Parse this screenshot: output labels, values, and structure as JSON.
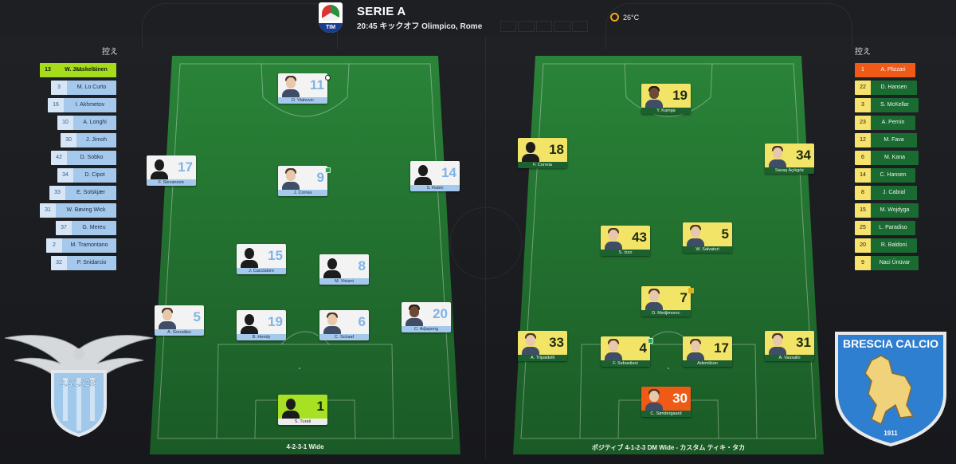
{
  "header": {
    "competition": "SERIE A",
    "subtitle": "20:45 キックオフ Olimpico, Rome",
    "temperature": "26°C",
    "weather_icon": "sun-icon",
    "logo_text": "TIM"
  },
  "home": {
    "bench_title": "控え",
    "formation": "4-2-3-1 Wide",
    "bench": [
      {
        "num": "13",
        "name": "W. Jääskeläinen"
      },
      {
        "num": "3",
        "name": "M. Lo Curto"
      },
      {
        "num": "16",
        "name": "I. Akhmetov"
      },
      {
        "num": "10",
        "name": "A. Longhi"
      },
      {
        "num": "30",
        "name": "J. Jimoh"
      },
      {
        "num": "42",
        "name": "D. Sobko"
      },
      {
        "num": "34",
        "name": "D. Cipot"
      },
      {
        "num": "33",
        "name": "E. Solskjær"
      },
      {
        "num": "31",
        "name": "W. Bøving Wick"
      },
      {
        "num": "37",
        "name": "G. Mereu"
      },
      {
        "num": "2",
        "name": "M. Tramontano"
      },
      {
        "num": "32",
        "name": "P. Snidarcio"
      }
    ],
    "players": [
      {
        "num": "11",
        "name": "D. Vlahovic"
      },
      {
        "num": "17",
        "name": "F. Stevanovic"
      },
      {
        "num": "9",
        "name": "J. Correa"
      },
      {
        "num": "14",
        "name": "S. Rabin"
      },
      {
        "num": "15",
        "name": "J. Cacciatore"
      },
      {
        "num": "8",
        "name": "M. Viviani"
      },
      {
        "num": "5",
        "name": "A. González"
      },
      {
        "num": "19",
        "name": "B. Hendy"
      },
      {
        "num": "6",
        "name": "C. Schaaf"
      },
      {
        "num": "20",
        "name": "C. Adjapong"
      },
      {
        "num": "1",
        "name": "S. Turati"
      }
    ],
    "crest_text": "S.S.LAZIO",
    "crest_color": "#9fc8ea"
  },
  "away": {
    "bench_title": "控え",
    "formation": "ポジティブ 4-1-2-3 DM Wide - カスタム ティキ・タカ",
    "bench": [
      {
        "num": "1",
        "name": "A. Plizzari"
      },
      {
        "num": "22",
        "name": "D. Hansen"
      },
      {
        "num": "3",
        "name": "S. McKellar"
      },
      {
        "num": "23",
        "name": "A. Pernin"
      },
      {
        "num": "12",
        "name": "M. Fava"
      },
      {
        "num": "6",
        "name": "M. Kana"
      },
      {
        "num": "14",
        "name": "C. Hansen"
      },
      {
        "num": "8",
        "name": "J. Cabral"
      },
      {
        "num": "15",
        "name": "M. Wojdyga"
      },
      {
        "num": "25",
        "name": "L. Paradiso"
      },
      {
        "num": "20",
        "name": "R. Baldoni"
      },
      {
        "num": "9",
        "name": "Naci Ünüvar"
      }
    ],
    "players": [
      {
        "num": "19",
        "name": "Y. Kamga"
      },
      {
        "num": "18",
        "name": "F. Correia"
      },
      {
        "num": "34",
        "name": "Savaş Açıkgöz"
      },
      {
        "num": "43",
        "name": "S. Izzo"
      },
      {
        "num": "5",
        "name": "W. Salvatori"
      },
      {
        "num": "7",
        "name": "D. Medjimorec"
      },
      {
        "num": "33",
        "name": "A. Tripaldelli"
      },
      {
        "num": "4",
        "name": "F. Sebastiani"
      },
      {
        "num": "17",
        "name": "Ademilson"
      },
      {
        "num": "31",
        "name": "A. Vassallo"
      },
      {
        "num": "30",
        "name": "C. Søndergaard"
      }
    ],
    "crest_text": "BRESCIA CALCIO",
    "crest_year": "1911",
    "crest_color": "#2f7fd0"
  },
  "colors": {
    "lazio_blue": "#a5c9ec",
    "lazio_gk": "#a8e024",
    "brescia_yellow": "#f2e466",
    "brescia_green": "#1d6030",
    "brescia_gk": "#ef5a17",
    "pitch_green": "#1f6a2c"
  }
}
